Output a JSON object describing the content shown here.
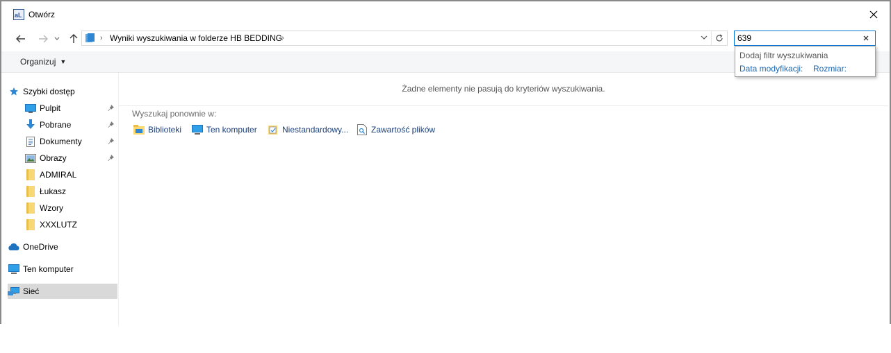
{
  "window": {
    "title": "Otwórz"
  },
  "nav": {
    "breadcrumb": "Wyniki wyszukiwania w folderze HB BEDDING",
    "search_value": "639"
  },
  "search_popup": {
    "header": "Dodaj filtr wyszukiwania",
    "filters": [
      "Data modyfikacji:",
      "Rozmiar:"
    ]
  },
  "commandbar": {
    "organize": "Organizuj"
  },
  "sidebar": {
    "items": [
      {
        "label": "Szybki dostęp",
        "icon": "star-icon"
      },
      {
        "label": "Pulpit",
        "icon": "desktop-icon",
        "pinned": true
      },
      {
        "label": "Pobrane",
        "icon": "download-icon",
        "pinned": true
      },
      {
        "label": "Dokumenty",
        "icon": "documents-icon",
        "pinned": true
      },
      {
        "label": "Obrazy",
        "icon": "pictures-icon",
        "pinned": true
      },
      {
        "label": "ADMIRAL",
        "icon": "folder-icon"
      },
      {
        "label": "Łukasz",
        "icon": "folder-icon"
      },
      {
        "label": "Wzory",
        "icon": "folder-icon"
      },
      {
        "label": "XXXLUTZ",
        "icon": "folder-icon"
      },
      {
        "label": "OneDrive",
        "icon": "cloud-icon"
      },
      {
        "label": "Ten komputer",
        "icon": "computer-icon"
      },
      {
        "label": "Sieć",
        "icon": "network-icon",
        "selected": true
      }
    ]
  },
  "content": {
    "empty_message": "Żadne elementy nie pasują do kryteriów wyszukiwania.",
    "search_again_label": "Wyszukaj ponownie w:",
    "search_again_items": [
      {
        "label": "Biblioteki",
        "icon": "libraries-icon"
      },
      {
        "label": "Ten komputer",
        "icon": "computer-icon"
      },
      {
        "label": "Niestandardowy...",
        "icon": "custom-folder-icon"
      },
      {
        "label": "Zawartość plików",
        "icon": "file-contents-icon"
      }
    ]
  },
  "colors": {
    "accent": "#0078d7",
    "link": "#1a66b3",
    "selected_bg": "#d9d9d9",
    "folder": "#f8d775"
  }
}
